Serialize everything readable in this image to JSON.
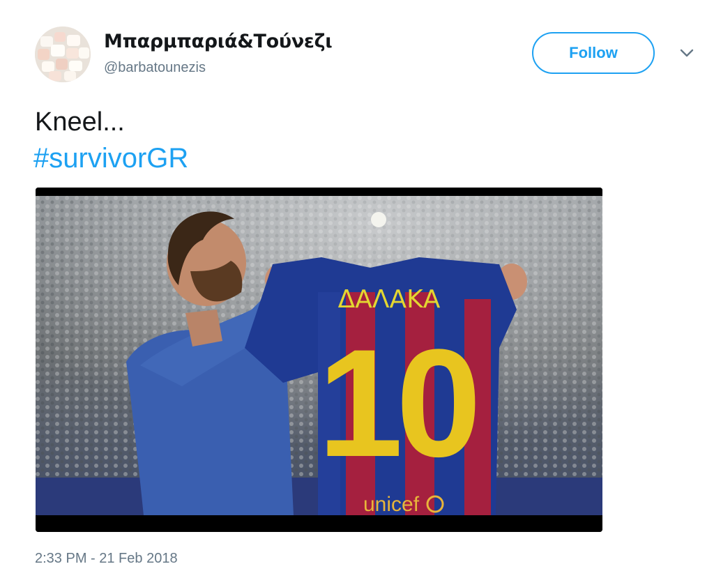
{
  "tweet": {
    "author": {
      "display_name": "Μπαρμπαριά&Τούνεζι",
      "handle": "@barbatounezis",
      "avatar_icon": "marshmallows-avatar"
    },
    "follow_label": "Follow",
    "more_icon": "chevron-down-icon",
    "text": "Kneel...",
    "hashtag": "#survivorGR",
    "media": {
      "jersey_name": "ΔΑΛΑΚΑ",
      "jersey_number": "10",
      "sponsor": "unicef"
    },
    "timestamp": "2:33 PM - 21 Feb 2018"
  },
  "colors": {
    "accent": "#1da1f2",
    "text": "#14171a",
    "secondary": "#657786"
  }
}
